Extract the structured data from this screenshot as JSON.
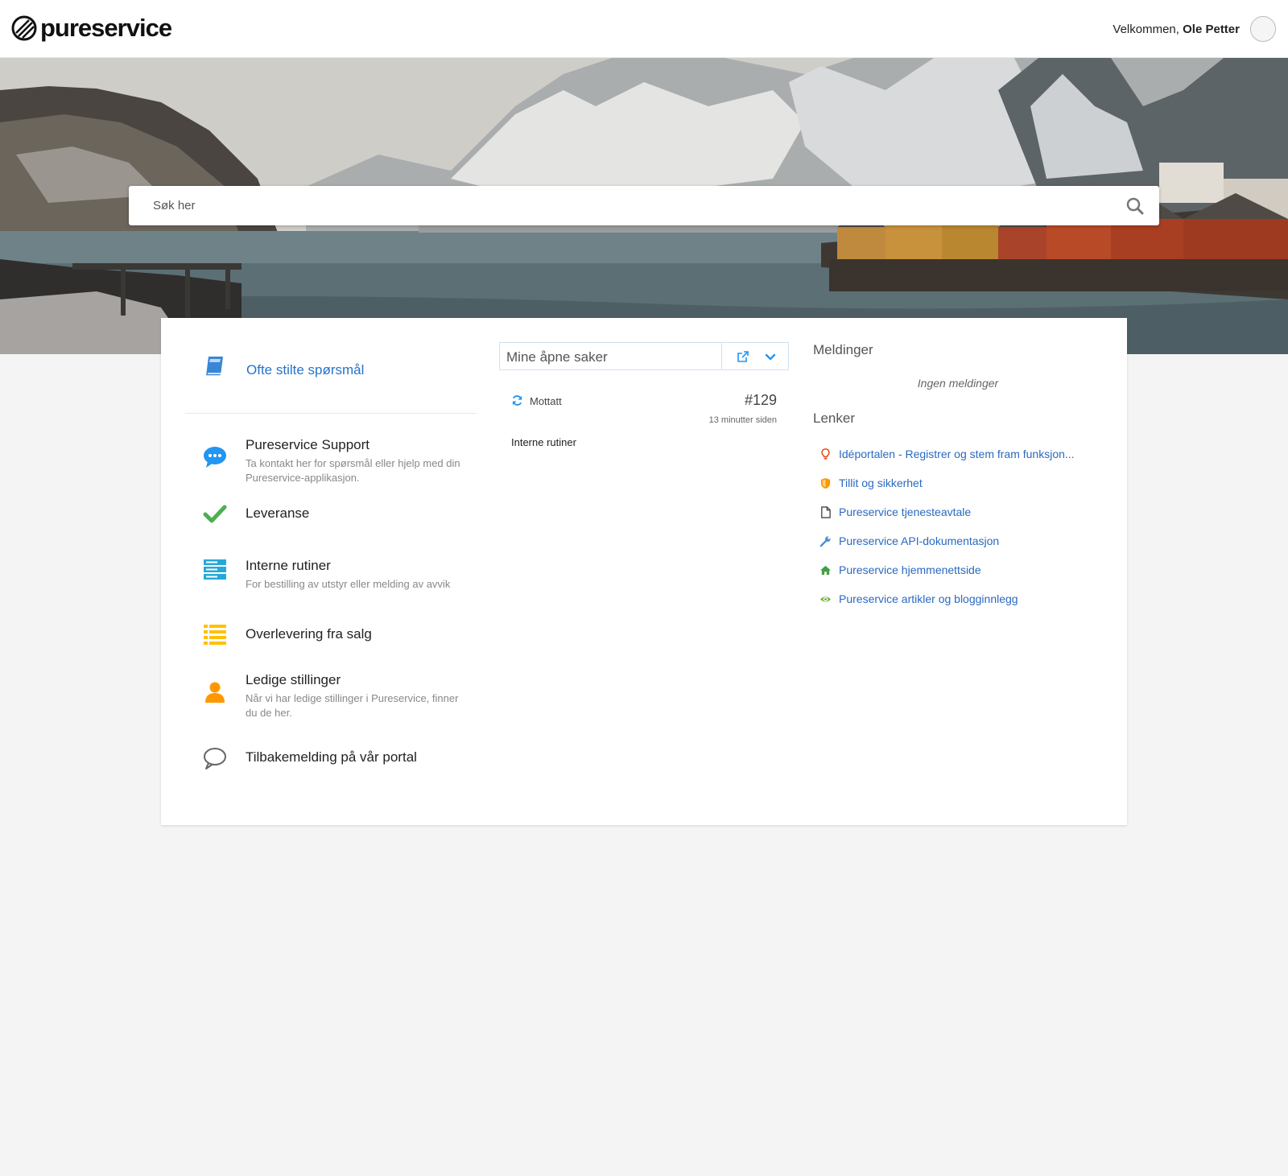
{
  "header": {
    "brand": "pureservice",
    "welcome_prefix": "Velkommen,",
    "user_name": "Ole Petter"
  },
  "search": {
    "placeholder": "Søk her"
  },
  "left": {
    "faq_label": "Ofte stilte spørsmål",
    "categories": [
      {
        "title": "Pureservice Support",
        "description": "Ta kontakt her for spørsmål eller hjelp med din Pureservice-applikasjon.",
        "icon": "chat-bubble-icon"
      },
      {
        "title": "Leveranse",
        "description": "",
        "icon": "checkmark-icon"
      },
      {
        "title": "Interne rutiner",
        "description": "For bestilling av utstyr eller melding av avvik",
        "icon": "server-icon"
      },
      {
        "title": "Overlevering fra salg",
        "description": "",
        "icon": "list-icon"
      },
      {
        "title": "Ledige stillinger",
        "description": "Når vi har ledige stillinger i Pureservice, finner du de her.",
        "icon": "person-icon"
      },
      {
        "title": "Tilbakemelding på vår portal",
        "description": "",
        "icon": "speech-bubble-outline-icon"
      }
    ]
  },
  "tickets": {
    "dropdown_label": "Mine åpne saker",
    "items": [
      {
        "status": "Mottatt",
        "number": "#129",
        "time": "13 minutter siden",
        "title": "Interne rutiner"
      }
    ]
  },
  "right": {
    "messages_heading": "Meldinger",
    "no_messages": "Ingen meldinger",
    "links_heading": "Lenker",
    "links": [
      {
        "label": "Idéportalen - Registrer og stem fram funksjon...",
        "icon": "lightbulb-icon"
      },
      {
        "label": "Tillit og sikkerhet",
        "icon": "shield-icon"
      },
      {
        "label": "Pureservice tjenesteavtale",
        "icon": "document-icon"
      },
      {
        "label": "Pureservice API-dokumentasjon",
        "icon": "wrench-icon"
      },
      {
        "label": "Pureservice hjemmenettside",
        "icon": "home-icon"
      },
      {
        "label": "Pureservice artikler og blogginnlegg",
        "icon": "eye-icon"
      }
    ]
  },
  "colors": {
    "link_blue": "#2a69c0",
    "accent_blue": "#2196f3",
    "check_green": "#4caf50",
    "list_yellow": "#ffc107",
    "person_orange": "#ff9800",
    "server_cyan": "#26a9d8"
  }
}
